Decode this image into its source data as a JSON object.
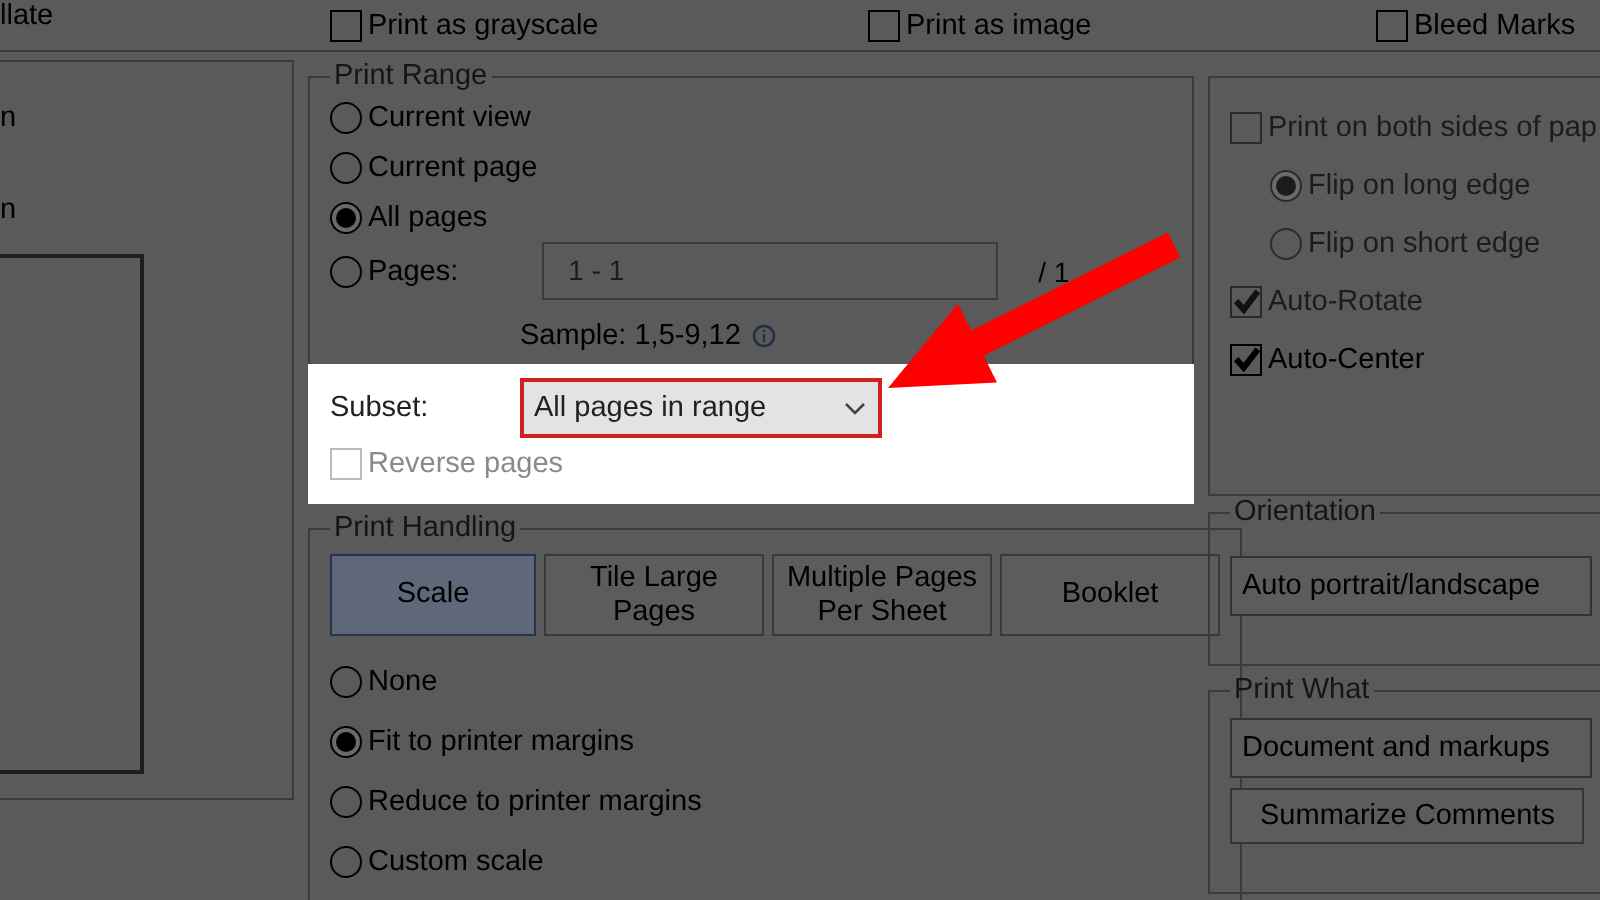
{
  "top_row": {
    "fragment": "llate",
    "checkboxes": [
      {
        "label": "Print as grayscale",
        "checked": false
      },
      {
        "label": "Print as image",
        "checked": false
      },
      {
        "label": "Bleed Marks",
        "checked": false
      }
    ]
  },
  "left_panel": {
    "fragments": [
      "n",
      "n"
    ]
  },
  "print_range": {
    "title": "Print Range",
    "options": [
      {
        "label": "Current view",
        "selected": false
      },
      {
        "label": "Current page",
        "selected": false
      },
      {
        "label": "All pages",
        "selected": true
      },
      {
        "label": "Pages:",
        "selected": false
      }
    ],
    "pages_field": {
      "value": "1 - 1"
    },
    "page_total": "/ 1",
    "sample": "Sample: 1,5-9,12",
    "subset": {
      "label": "Subset:",
      "value": "All pages in range",
      "highlighted": true
    },
    "reverse_pages": {
      "label": "Reverse pages",
      "checked": false,
      "disabled": true
    }
  },
  "print_handling": {
    "title": "Print Handling",
    "tabs": [
      {
        "label": "Scale",
        "selected": true
      },
      {
        "label": "Tile Large Pages",
        "selected": false
      },
      {
        "label": "Multiple Pages Per Sheet",
        "selected": false
      },
      {
        "label": "Booklet",
        "selected": false
      }
    ],
    "options": [
      {
        "label": "None",
        "selected": false
      },
      {
        "label": "Fit to printer margins",
        "selected": true
      },
      {
        "label": "Reduce to printer margins",
        "selected": false
      },
      {
        "label": "Custom scale",
        "selected": false
      }
    ]
  },
  "page_options": [
    {
      "kind": "checkbox",
      "label": "Print on both sides of pap",
      "checked": false,
      "disabled": true,
      "children": [
        {
          "kind": "radio",
          "label": "Flip on long edge",
          "selected": true,
          "disabled": true
        },
        {
          "kind": "radio",
          "label": "Flip on short edge",
          "selected": false,
          "disabled": true
        }
      ]
    },
    {
      "kind": "checkbox",
      "label": "Auto-Rotate",
      "checked": true,
      "disabled": true
    },
    {
      "kind": "checkbox",
      "label": "Auto-Center",
      "checked": true,
      "disabled": false
    }
  ],
  "orientation": {
    "title": "Orientation",
    "value": "Auto portrait/landscape"
  },
  "print_what": {
    "title": "Print What",
    "value": "Document and markups",
    "button": "Summarize Comments"
  }
}
